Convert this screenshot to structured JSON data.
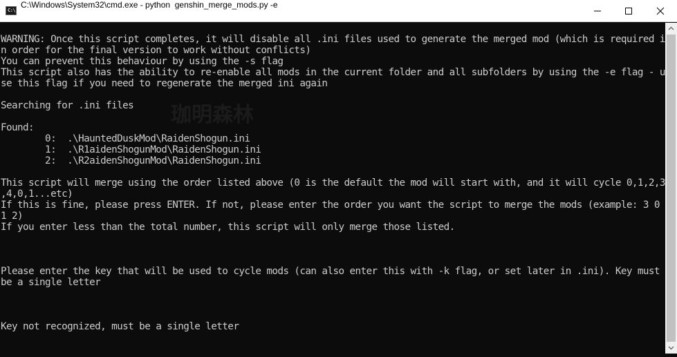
{
  "window": {
    "icon": "cmd-icon",
    "icon_text": "C:\\",
    "title": "C:\\Windows\\System32\\cmd.exe - python  genshin_merge_mods.py -e",
    "controls": [
      "minimize-icon",
      "maximize-icon",
      "close-icon"
    ]
  },
  "watermark": "珈明森林",
  "console": {
    "lines": [
      "",
      "WARNING: Once this script completes, it will disable all .ini files used to generate the merged mod (which is required i",
      "n order for the final version to work without conflicts)",
      "You can prevent this behaviour by using the -s flag",
      "This script also has the ability to re-enable all mods in the current folder and all subfolders by using the -e flag - u",
      "se this flag if you need to regenerate the merged ini again",
      "",
      "Searching for .ini files",
      "",
      "Found:",
      "        0:  .\\HauntedDuskMod\\RaidenShogun.ini",
      "        1:  .\\R1aidenShogunMod\\RaidenShogun.ini",
      "        2:  .\\R2aidenShogunMod\\RaidenShogun.ini",
      "",
      "This script will merge using the order listed above (0 is the default the mod will start with, and it will cycle 0,1,2,3",
      ",4,0,1...etc)",
      "If this is fine, please press ENTER. If not, please enter the order you want the script to merge the mods (example: 3 0",
      "1 2)",
      "If you enter less than the total number, this script will only merge those listed.",
      "",
      "",
      "",
      "Please enter the key that will be used to cycle mods (can also enter this with -k flag, or set later in .ini). Key must",
      "be a single letter",
      "",
      "",
      "",
      "Key not recognized, must be a single letter",
      "",
      ""
    ]
  },
  "colors": {
    "console_bg": "#0c0c0c",
    "console_fg": "#cccccc",
    "titlebar_bg": "#ffffff",
    "scrollbar_bg": "#f0f0f0",
    "scrollbar_thumb": "#c1c1c1"
  }
}
